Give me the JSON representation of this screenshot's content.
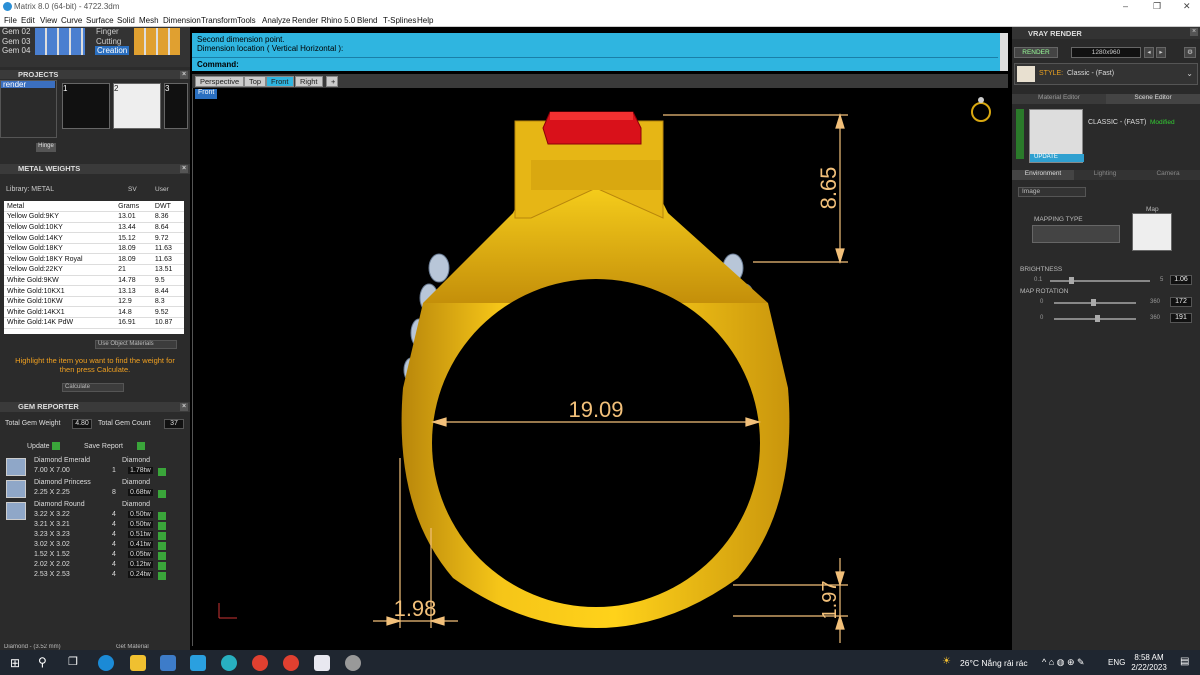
{
  "window": {
    "title": "Matrix 8.0 (64-bit) - 4722.3dm"
  },
  "menu": [
    "File",
    "Edit",
    "View",
    "Curve",
    "Surface",
    "Solid",
    "Mesh",
    "Dimension",
    "Transform",
    "Tools",
    "Analyze",
    "Render",
    "Rhino 5.0",
    "Blend",
    "T-Splines",
    "Help"
  ],
  "layers": {
    "rows": [
      "Gem 02",
      "Gem 03",
      "Gem 04"
    ],
    "right": [
      "Finger",
      "Cutting",
      "Creation"
    ]
  },
  "projects": {
    "title": "PROJECTS",
    "item": "render",
    "thumbs": [
      "1",
      "2",
      "3"
    ],
    "hinge": "Hinge"
  },
  "metal_weights": {
    "title": "METAL WEIGHTS",
    "library": "Library: METAL",
    "sv": "SV",
    "user": "User",
    "headers": [
      "Metal",
      "Grams",
      "DWT"
    ],
    "rows": [
      [
        "Yellow Gold:9KY",
        "13.01",
        "8.36"
      ],
      [
        "Yellow Gold:10KY",
        "13.44",
        "8.64"
      ],
      [
        "Yellow Gold:14KY",
        "15.12",
        "9.72"
      ],
      [
        "Yellow Gold:18KY",
        "18.09",
        "11.63"
      ],
      [
        "Yellow Gold:18KY Royal",
        "18.09",
        "11.63"
      ],
      [
        "Yellow Gold:22KY",
        "21",
        "13.51"
      ],
      [
        "White Gold:9KW",
        "14.78",
        "9.5"
      ],
      [
        "White Gold:10KX1",
        "13.13",
        "8.44"
      ],
      [
        "White Gold:10KW",
        "12.9",
        "8.3"
      ],
      [
        "White Gold:14KX1",
        "14.8",
        "9.52"
      ],
      [
        "White Gold:14K PdW",
        "16.91",
        "10.87"
      ]
    ],
    "use_obj": "Use Object Materials",
    "hint": "Highlight the item you want to find the weight for then press Calculate.",
    "calc": "Calculate"
  },
  "gem_reporter": {
    "title": "GEM REPORTER",
    "tgw_label": "Total Gem Weight",
    "tgw": "4.80",
    "tgc_label": "Total Gem Count",
    "tgc": "37",
    "update": "Update",
    "save": "Save Report",
    "groups": [
      {
        "name": "Diamond Emerald",
        "mat": "Diamond",
        "rows": [
          [
            "7.00 X 7.00",
            "1",
            "1.78tw"
          ]
        ]
      },
      {
        "name": "Diamond Princess",
        "mat": "Diamond",
        "rows": [
          [
            "2.25 X 2.25",
            "8",
            "0.68tw"
          ]
        ]
      },
      {
        "name": "Diamond Round",
        "mat": "Diamond",
        "rows": [
          [
            "3.22 X 3.22",
            "4",
            "0.50tw"
          ],
          [
            "3.21 X 3.21",
            "4",
            "0.50tw"
          ],
          [
            "3.23 X 3.23",
            "4",
            "0.51tw"
          ],
          [
            "3.02 X 3.02",
            "4",
            "0.41tw"
          ],
          [
            "1.52 X 1.52",
            "4",
            "0.05tw"
          ],
          [
            "2.02 X 2.02",
            "4",
            "0.12tw"
          ],
          [
            "2.53 X 2.53",
            "4",
            "0.24tw"
          ]
        ]
      }
    ],
    "bottom_left": "Diamond - (3.52 mm)",
    "bottom_right": "Get Material"
  },
  "command": {
    "line1": "Second dimension point.",
    "line2": "Dimension location ( Vertical  Horizontal ):",
    "label": "Command:"
  },
  "viewtabs": [
    "Perspective",
    "Top",
    "Front",
    "Right"
  ],
  "viewport": {
    "name": "Front",
    "dims": {
      "top_height": "8.65",
      "inner_width": "19.09",
      "bottom_thickness": "1.97",
      "side_thickness": "1.98"
    }
  },
  "vray": {
    "title": "VRAY RENDER",
    "render": "RENDER",
    "resolution": "1280x960",
    "style_label": "STYLE:",
    "style": "Classic - (Fast)",
    "tabs": [
      "Material Editor",
      "Scene Editor"
    ],
    "preset": "CLASSIC - (FAST)",
    "modified": "Modified",
    "update": "UPDATE",
    "subtabs": [
      "Environment",
      "Lighting",
      "Camera"
    ],
    "env_type": "Image",
    "mapping_type": "MAPPING TYPE",
    "map": "Map",
    "brightness": {
      "label": "BRIGHTNESS",
      "min": "0.1",
      "max": "5",
      "value": "1.06",
      "level": 0.2
    },
    "rotation": {
      "label": "MAP ROTATION",
      "r1": {
        "min": "0",
        "max": "360",
        "value": "172"
      },
      "r2": {
        "min": "0",
        "max": "360",
        "value": "191"
      }
    }
  },
  "taskbar": {
    "weather": "26°C  Nắng rải rác",
    "lang": "ENG",
    "time": "8:58 AM",
    "date": "2/22/2023"
  }
}
